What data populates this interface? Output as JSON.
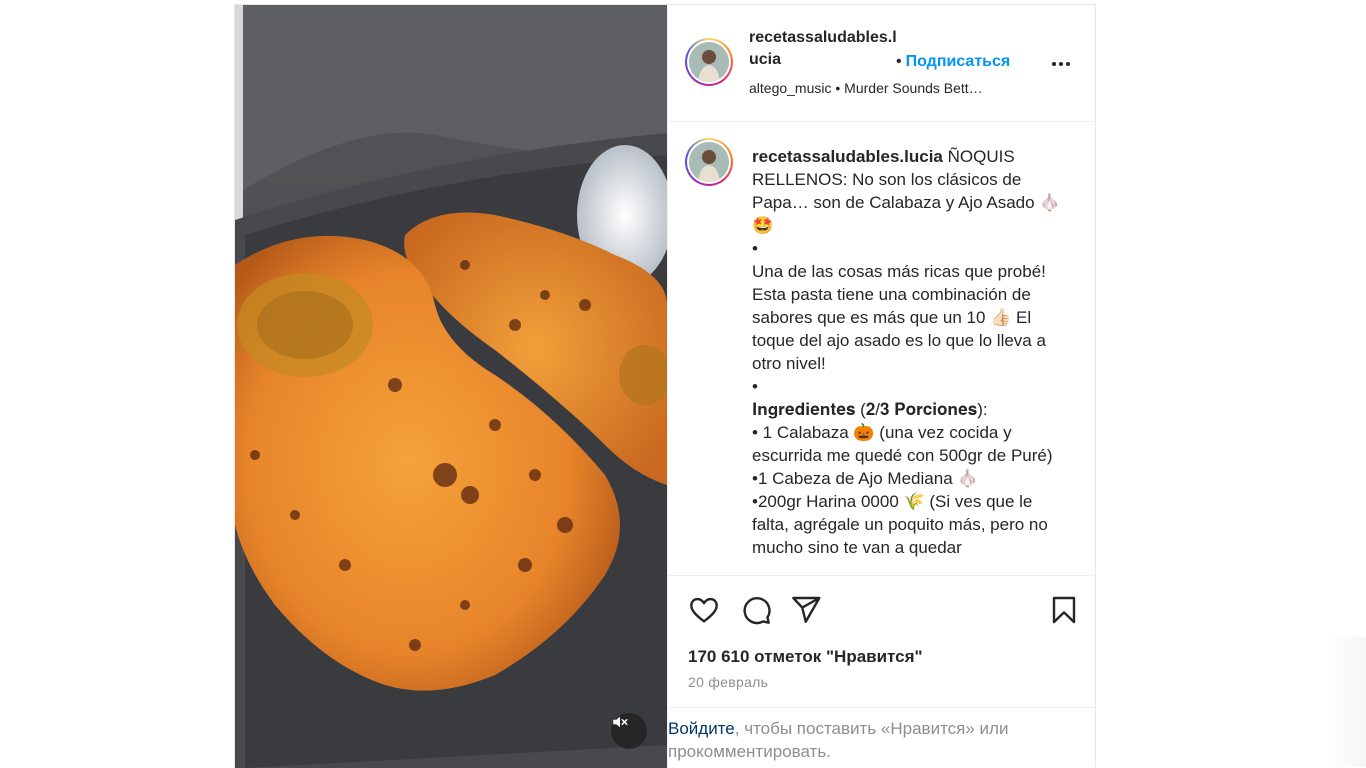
{
  "post": {
    "username_header": "recetassaludables.lucia",
    "follow_dot": "•",
    "follow_label": "Подписаться",
    "audio_label": "altego_music • Murder Sounds Bett…",
    "caption_username": "recetassaludables.lucia",
    "caption_text": " ÑOQUIS RELLENOS: No son los clásicos de Papa… son de Calabaza y Ajo Asado 🧄🤩\n•\nUna de las cosas más ricas que probé! Esta pasta tiene una combinación de sabores que es más que un 10 👍🏻 El toque del ajo asado es lo que lo lleva a otro nivel!\n•\n𝐈𝐧𝐠𝐫𝐞𝐝𝐢𝐞𝐧𝐭𝐞𝐬 (𝟐/𝟑 𝐏𝐨𝐫𝐜𝐢𝐨𝐧𝐞𝐬):\n• 1 Calabaza 🎃 (una vez cocida y escurrida me quedé con 500gr de Puré)\n•1 Cabeza de Ajo Mediana 🧄\n•200gr Harina 0000 🌾 (Si ves que le falta, agrégale un poquito más, pero no mucho sino te van a quedar",
    "likes": "170 610 отметок \"Нравится\"",
    "date": "20 февраль",
    "login_link": "Войдите",
    "login_rest": ", чтобы поставить «Нравится» или прокомментировать."
  },
  "icons": {
    "like": "heart-icon",
    "comment": "comment-icon",
    "share": "paper-plane-icon",
    "save": "bookmark-icon",
    "more": "more-dots-icon",
    "mute": "speaker-muted-icon"
  },
  "colors": {
    "link_blue": "#0095f6",
    "login_link": "#00376b",
    "muted_text": "#8e8e8e",
    "text": "#262626"
  }
}
